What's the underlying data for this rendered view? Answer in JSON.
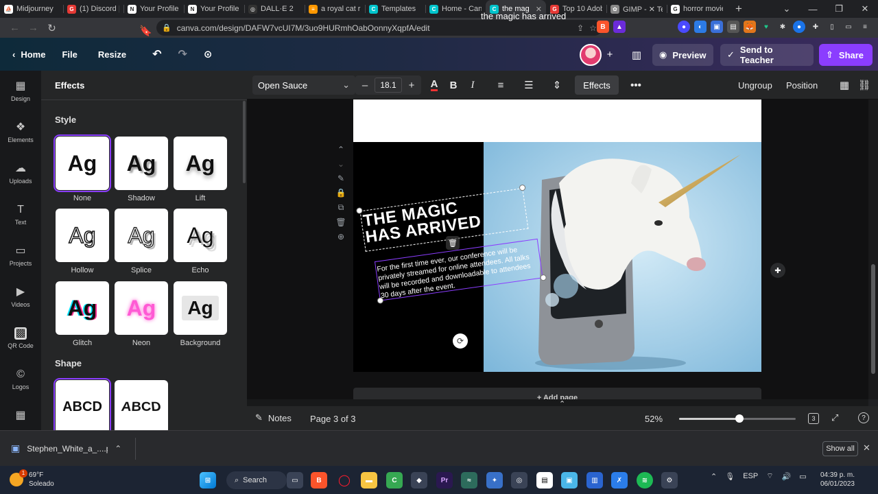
{
  "browser": {
    "tabs": [
      {
        "label": "Midjourney",
        "fav_color": "#ffffff",
        "fav_glyph": "⛵"
      },
      {
        "label": "(1) Discord |",
        "fav_color": "#e53935",
        "fav_glyph": "G"
      },
      {
        "label": "Your Profile",
        "fav_color": "#ffffff",
        "fav_glyph": "N"
      },
      {
        "label": "Your Profile",
        "fav_color": "#ffffff",
        "fav_glyph": "N"
      },
      {
        "label": "DALL·E 2",
        "fav_color": "#333333",
        "fav_glyph": "◎"
      },
      {
        "label": "a royal cat ri",
        "fav_color": "#ff9800",
        "fav_glyph": "≡"
      },
      {
        "label": "Templates",
        "fav_color": "#00c4cc",
        "fav_glyph": "C"
      },
      {
        "label": "Home - Canv",
        "fav_color": "#00c4cc",
        "fav_glyph": "C"
      },
      {
        "label": "the mag",
        "fav_color": "#00c4cc",
        "fav_glyph": "C",
        "active": true
      },
      {
        "label": "Top 10 Adob",
        "fav_color": "#e53935",
        "fav_glyph": "G"
      },
      {
        "label": "GIMP - ✕ Te",
        "fav_color": "#888888",
        "fav_glyph": "✿"
      },
      {
        "label": "horror movie",
        "fav_color": "#ffffff",
        "fav_glyph": "G"
      }
    ],
    "url": "canva.com/design/DAFW7vcUI7M/3uo9HURmhOabOonnyXqpfA/edit"
  },
  "header": {
    "home": "Home",
    "file": "File",
    "resize": "Resize",
    "doc_title": "the magic has arrived",
    "preview": "Preview",
    "send_to_teacher": "Send to Teacher",
    "share": "Share"
  },
  "rail": {
    "items": [
      {
        "label": "Design",
        "icon": "design-icon",
        "glyph": "▦"
      },
      {
        "label": "Elements",
        "icon": "elements-icon",
        "glyph": "❖"
      },
      {
        "label": "Uploads",
        "icon": "uploads-icon",
        "glyph": "☁"
      },
      {
        "label": "Text",
        "icon": "text-icon",
        "glyph": "T"
      },
      {
        "label": "Projects",
        "icon": "projects-icon",
        "glyph": "▭"
      },
      {
        "label": "Videos",
        "icon": "videos-icon",
        "glyph": "▶"
      },
      {
        "label": "QR Code",
        "icon": "qr-code-icon",
        "glyph": "▩"
      },
      {
        "label": "Logos",
        "icon": "logos-icon",
        "glyph": "©"
      }
    ]
  },
  "panel": {
    "title": "Effects",
    "style_title": "Style",
    "shape_title": "Shape",
    "styles": [
      {
        "label": "None",
        "selected": true
      },
      {
        "label": "Shadow"
      },
      {
        "label": "Lift"
      },
      {
        "label": "Hollow"
      },
      {
        "label": "Splice"
      },
      {
        "label": "Echo"
      },
      {
        "label": "Glitch"
      },
      {
        "label": "Neon"
      },
      {
        "label": "Background"
      }
    ],
    "tile_text": "Ag",
    "shapes": [
      {
        "label": "ABCD",
        "selected": true
      },
      {
        "label": "ABCD"
      }
    ]
  },
  "toolbar": {
    "font": "Open Sauce",
    "font_size": "18.1",
    "effects": "Effects",
    "ungroup": "Ungroup",
    "position": "Position"
  },
  "canvas": {
    "heading_line1": "THE MAGIC",
    "heading_line2": "HAS ARRIVED",
    "body": "For the first time ever, our conference will be privately streamed for online attendees. All talks will be recorded and downloadable to attendees 30 days after the event.",
    "add_page": "+ Add page"
  },
  "footer": {
    "notes": "Notes",
    "page_indicator": "Page 3 of 3",
    "zoom": "52%",
    "zoom_fraction": 0.52,
    "page_count_badge": "3"
  },
  "download": {
    "filename": "Stephen_White_a_....png",
    "show_all": "Show all"
  },
  "taskbar": {
    "weather_temp": "69°F",
    "weather_cond": "Soleado",
    "weather_badge": "1",
    "search": "Search",
    "lang": "ESP",
    "time": "04:39 p. m.",
    "date": "06/01/2023"
  },
  "colors": {
    "accent": "#8b3dff",
    "canva_teal": "#00c4cc"
  }
}
